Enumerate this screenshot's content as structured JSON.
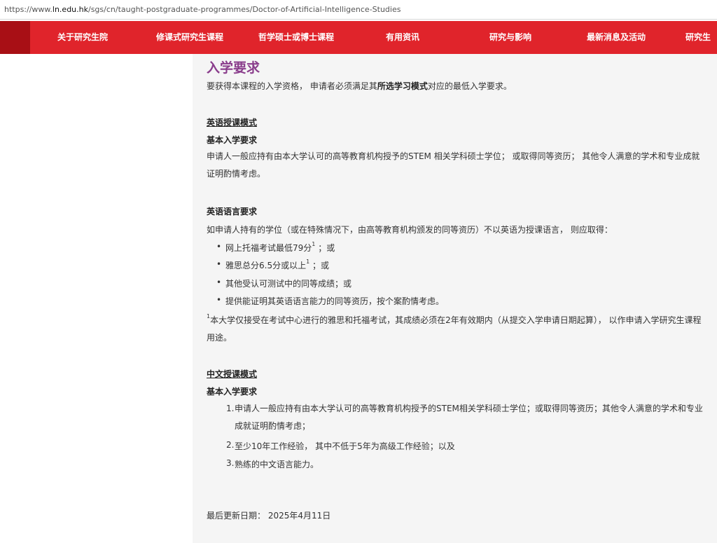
{
  "browser": {
    "url_prefix": "https://www.",
    "url_host": "ln.edu.hk",
    "url_path": "/sgs/cn/taught-postgraduate-programmes/Doctor-of-Artificial-Intelligence-Studies"
  },
  "nav": {
    "items": [
      "关于研究生院",
      "修课式研究生课程",
      "哲学硕士或博士课程",
      "有用资讯",
      "研究与影响",
      "最新消息及活动",
      "研究生"
    ]
  },
  "colors": {
    "nav_bg": "#e0242b",
    "brand_block": "#a80f15",
    "title": "#8a3d8c"
  },
  "content": {
    "title": "入学要求",
    "intro_before": "要获得本课程的入学资格， 申请者必须满足其",
    "intro_bold": "所选学习模式",
    "intro_after": "对应的最低入学要求。",
    "english_mode": {
      "heading": "英语授课模式",
      "basic_heading": "基本入学要求",
      "basic_text": "申请人一般应持有由本大学认可的高等教育机构授予的STEM 相关学科硕士学位； 或取得同等资历； 其他令人满意的学术和专业成就证明酌情考虑。",
      "lang_heading": "英语语言要求",
      "lang_intro": "如申请人持有的学位（或在特殊情况下，由高等教育机构颁发的同等资历）不以英语为授课语言， 则应取得：",
      "lang_items": [
        {
          "text": "网上托福考试最低79分",
          "sup": "1",
          "tail": "；或"
        },
        {
          "text": "雅思总分6.5分或以上",
          "sup": "1",
          "tail": "；或"
        },
        {
          "text": "其他受认可测试中的同等成绩；或",
          "sup": "",
          "tail": ""
        },
        {
          "text": "提供能证明其英语语言能力的同等资历，按个案酌情考虑。",
          "sup": "",
          "tail": ""
        }
      ],
      "footnote_mark": "1",
      "footnote": "本大学仅接受在考试中心进行的雅思和托福考试，其成绩必须在2年有效期内（从提交入学申请日期起算）， 以作申请入学研究生课程用途。"
    },
    "chinese_mode": {
      "heading": "中文授课模式",
      "basic_heading": "基本入学要求",
      "items": [
        {
          "num": "1.",
          "text": "申请人一般应持有由本大学认可的高等教育机构授予的STEM相关学科硕士学位；或取得同等资历；其他令人满意的学术和专业成就证明酌情考虑；"
        },
        {
          "num": "2.",
          "text": "至少10年工作经验， 其中不低于5年为高级工作经验；以及"
        },
        {
          "num": "3.",
          "text": "熟练的中文语言能力。"
        }
      ]
    },
    "last_updated": "最后更新日期： 2025年4月11日"
  }
}
